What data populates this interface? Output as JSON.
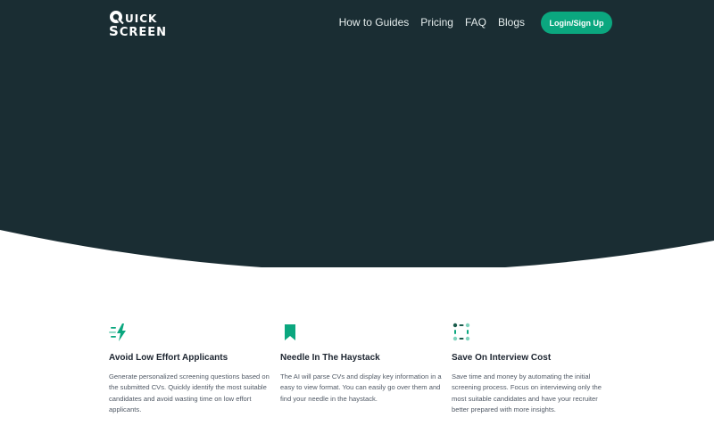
{
  "brand": {
    "logo_line1": "UICK",
    "logo_line2_initial": "S",
    "logo_line2_rest": "CREEN"
  },
  "nav": {
    "items": [
      {
        "label": "How to Guides"
      },
      {
        "label": "Pricing"
      },
      {
        "label": "FAQ"
      },
      {
        "label": "Blogs"
      }
    ],
    "login_label": "Login/Sign Up"
  },
  "features": [
    {
      "icon": "lightning-speed-icon",
      "title": "Avoid Low Effort Applicants",
      "text": "Generate personalized screening questions based on the submitted CVs. Quickly identify the most suitable candidates and avoid wasting time on low effort applicants."
    },
    {
      "icon": "bookmark-icon",
      "title": "Needle In The Haystack",
      "text": "The AI will parse CVs and display key information in a easy to view format. You can easily go over them and find your needle in the haystack."
    },
    {
      "icon": "dots-grid-icon",
      "title": "Save On Interview Cost",
      "text": "Save time and money by automating the initial screening process. Focus on interviewing only the most suitable candidates and have your recruiter better prepared with more insights."
    }
  ],
  "colors": {
    "hero_bg": "#1a2d33",
    "accent": "#0ba77f",
    "text_dark": "#1d2530",
    "text_body": "#515a66"
  }
}
